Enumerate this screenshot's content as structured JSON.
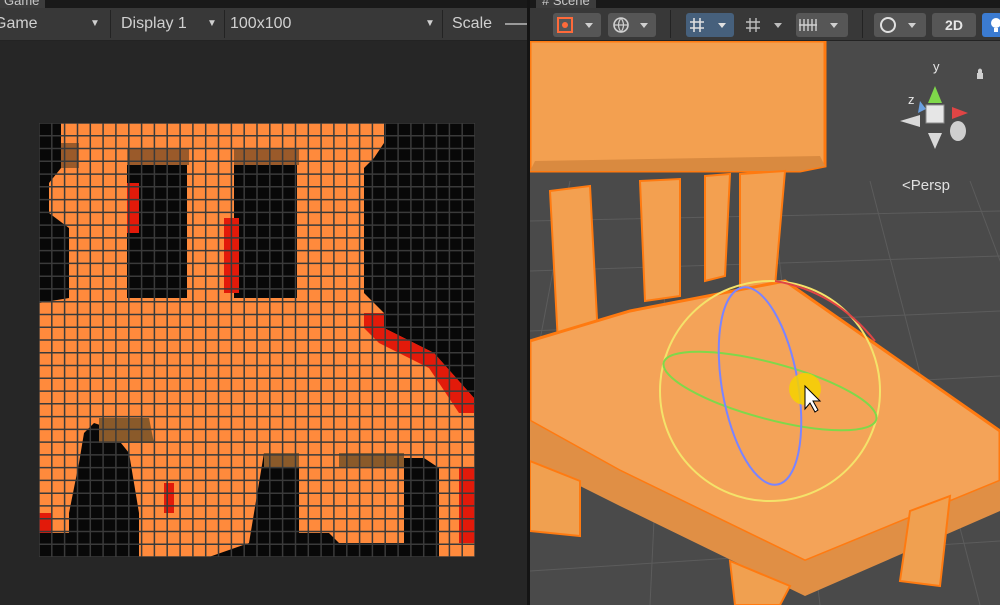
{
  "game": {
    "tab_title": "Game",
    "toolbar": {
      "mode_label": "Game",
      "display_label": "Display 1",
      "resolution_label": "100x100",
      "scale_label": "Scale"
    }
  },
  "scene": {
    "tab_title": "Scene",
    "toolbar": {
      "two_d_label": "2D"
    },
    "gizmo": {
      "y_label": "y",
      "z_label": "z",
      "projection_label": "Persp"
    }
  },
  "colors": {
    "chair_orange": "#f09a4e",
    "pixel_orange": "#ff8a3c",
    "pixel_red": "#e21a0a",
    "pixel_dark": "#080808",
    "grid_line": "#3a3a3a",
    "active_button": "#46607c"
  }
}
